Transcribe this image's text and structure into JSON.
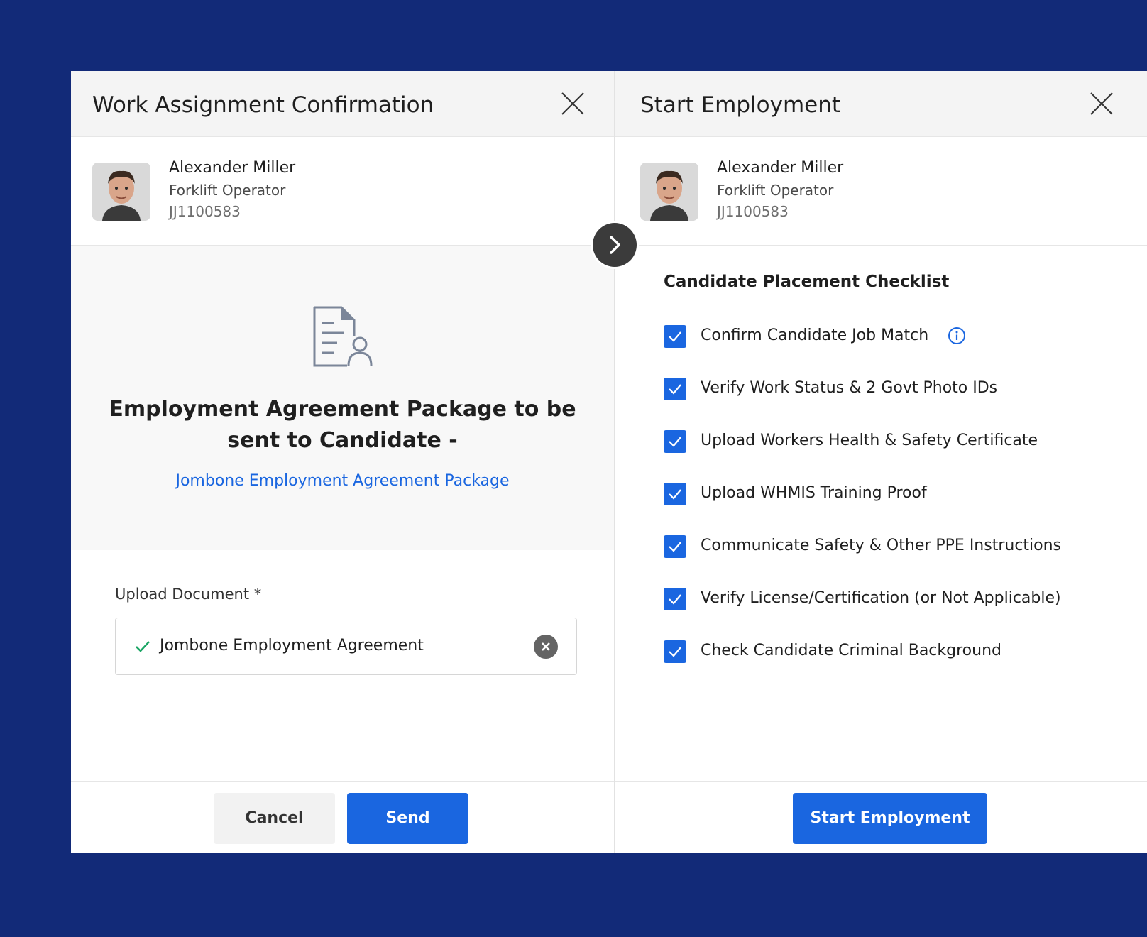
{
  "left_panel": {
    "title": "Work Assignment Confirmation",
    "candidate": {
      "name": "Alexander Miller",
      "role": "Forklift Operator",
      "id": "JJ1100583"
    },
    "package": {
      "heading": "Employment Agreement Package to be sent to Candidate -",
      "link": "Jombone Employment Agreement Package"
    },
    "upload": {
      "label": "Upload Document *",
      "file_name": "Jombone Employment Agreement"
    },
    "buttons": {
      "cancel": "Cancel",
      "send": "Send"
    }
  },
  "right_panel": {
    "title": "Start Employment",
    "candidate": {
      "name": "Alexander Miller",
      "role": "Forklift Operator",
      "id": "JJ1100583"
    },
    "checklist": {
      "title": "Candidate Placement Checklist",
      "items": [
        {
          "label": "Confirm Candidate Job Match",
          "checked": true
        },
        {
          "label": "Verify Work Status & 2 Govt Photo IDs",
          "checked": true
        },
        {
          "label": "Upload Workers Health & Safety Certificate",
          "checked": true
        },
        {
          "label": "Upload WHMIS Training Proof",
          "checked": true
        },
        {
          "label": "Communicate Safety & Other PPE Instructions",
          "checked": true
        },
        {
          "label": "Verify License/Certification (or Not Applicable)",
          "checked": true
        },
        {
          "label": "Check Candidate Criminal Background",
          "checked": true
        }
      ]
    },
    "buttons": {
      "start": "Start Employment"
    }
  },
  "colors": {
    "background": "#122a78",
    "accent": "#1a66e0",
    "success": "#1aa564"
  },
  "icons": [
    "close-icon",
    "document-user-icon",
    "check-icon",
    "clear-icon",
    "chevron-right-icon",
    "info-icon",
    "checkbox-checked-icon"
  ]
}
